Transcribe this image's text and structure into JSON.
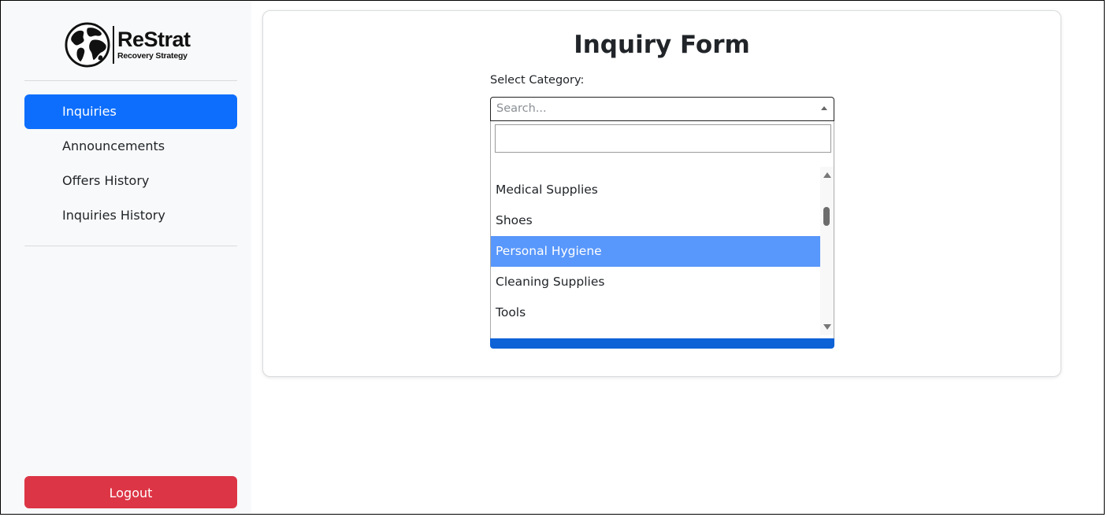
{
  "sidebar": {
    "logo": {
      "name": "ReStrat",
      "tagline": "Recovery Strategy"
    },
    "items": [
      {
        "label": "Inquiries",
        "active": true
      },
      {
        "label": "Announcements",
        "active": false
      },
      {
        "label": "Offers History",
        "active": false
      },
      {
        "label": "Inquiries History",
        "active": false
      }
    ],
    "logout_label": "Logout"
  },
  "form": {
    "title": "Inquiry Form",
    "category_label": "Select Category:",
    "select_placeholder": "Search...",
    "dropdown_search_value": "",
    "options": [
      {
        "label": "Medical Supplies",
        "highlighted": false
      },
      {
        "label": "Shoes",
        "highlighted": false
      },
      {
        "label": "Personal Hygiene",
        "highlighted": true
      },
      {
        "label": "Cleaning Supplies",
        "highlighted": false
      },
      {
        "label": "Tools",
        "highlighted": false
      }
    ]
  },
  "colors": {
    "primary": "#0d6efd",
    "danger": "#dc3545",
    "highlight": "#5897fb",
    "sidebar_bg": "#f8f9fa"
  },
  "icons": [
    "globe-icon",
    "caret-up-icon",
    "scroll-up-icon",
    "scroll-down-icon"
  ]
}
